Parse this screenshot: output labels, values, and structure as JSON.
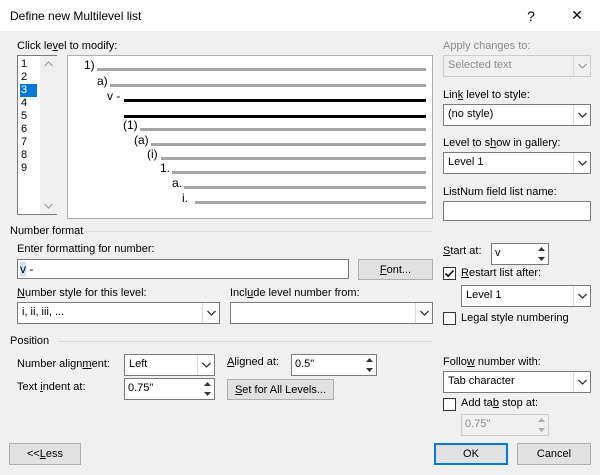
{
  "window": {
    "title": "Define new Multilevel list",
    "help_glyph": "?",
    "close_glyph": "✕"
  },
  "levels": {
    "label_pre": "Click le",
    "label_u": "v",
    "label_post": "el to modify:",
    "items": [
      "1",
      "2",
      "3",
      "4",
      "5",
      "6",
      "7",
      "8",
      "9"
    ],
    "selected": "3"
  },
  "preview": {
    "rows": [
      "1)",
      "a)",
      "v -",
      "",
      "(1)",
      "(a)",
      "(i)",
      "1.",
      "a.",
      "i."
    ]
  },
  "right_panel": {
    "apply_changes_label": "Apply changes to:",
    "apply_changes_value": "Selected text",
    "link_level_label_pre": "Lin",
    "link_level_label_u": "k",
    "link_level_label_post": " level to style:",
    "link_level_value": "(no style)",
    "level_gallery_label_pre": "Level to s",
    "level_gallery_label_u": "h",
    "level_gallery_label_post": "ow in gallery:",
    "level_gallery_value": "Level 1",
    "listnum_label": "ListNum field list name:",
    "listnum_value": ""
  },
  "number_format": {
    "section_label": "Number format",
    "enter_formatting_label_pre": "Enter formattin",
    "enter_formatting_label_u": "g",
    "enter_formatting_label_post": " for number:",
    "formatting_selected": "v",
    "formatting_rest": " -",
    "font_button_u": "F",
    "font_button_rest": "ont...",
    "style_label_pre": "",
    "style_label_u": "N",
    "style_label_post": "umber style for this level:",
    "style_value": "i, ii, iii, ...",
    "include_level_label_pre": "Incl",
    "include_level_label_u": "u",
    "include_level_label_post": "de level number from:",
    "include_level_value": "",
    "start_at_label_pre": "",
    "start_at_label_u": "S",
    "start_at_label_post": "tart at:",
    "start_at_value": "v",
    "restart_label_pre": "",
    "restart_label_u": "R",
    "restart_label_post": "estart list after:",
    "restart_checked": true,
    "restart_value": "Level 1",
    "legal_label_pre": "Le",
    "legal_label_u": "g",
    "legal_label_post": "al style numbering",
    "legal_checked": false
  },
  "position": {
    "section_label": "Position",
    "alignment_label_pre": "Number align",
    "alignment_label_u": "m",
    "alignment_label_post": "ent:",
    "alignment_value": "Left",
    "aligned_at_label_pre": "",
    "aligned_at_label_u": "A",
    "aligned_at_label_post": "ligned at:",
    "aligned_at_value": "0.5\"",
    "indent_label_pre": "Text ",
    "indent_label_u": "i",
    "indent_label_post": "ndent at:",
    "indent_value": "0.75\"",
    "set_all_u": "S",
    "set_all_rest": "et for All Levels...",
    "follow_label_pre": "Follo",
    "follow_label_u": "w",
    "follow_label_post": " number with:",
    "follow_value": "Tab character",
    "tab_stop_label_pre": "Add ta",
    "tab_stop_label_u": "b",
    "tab_stop_label_post": " stop at:",
    "tab_stop_checked": false,
    "tab_stop_value": "0.75\""
  },
  "buttons": {
    "less_pre": "<< ",
    "less_u": "L",
    "less_post": "ess",
    "ok": "OK",
    "cancel": "Cancel"
  }
}
